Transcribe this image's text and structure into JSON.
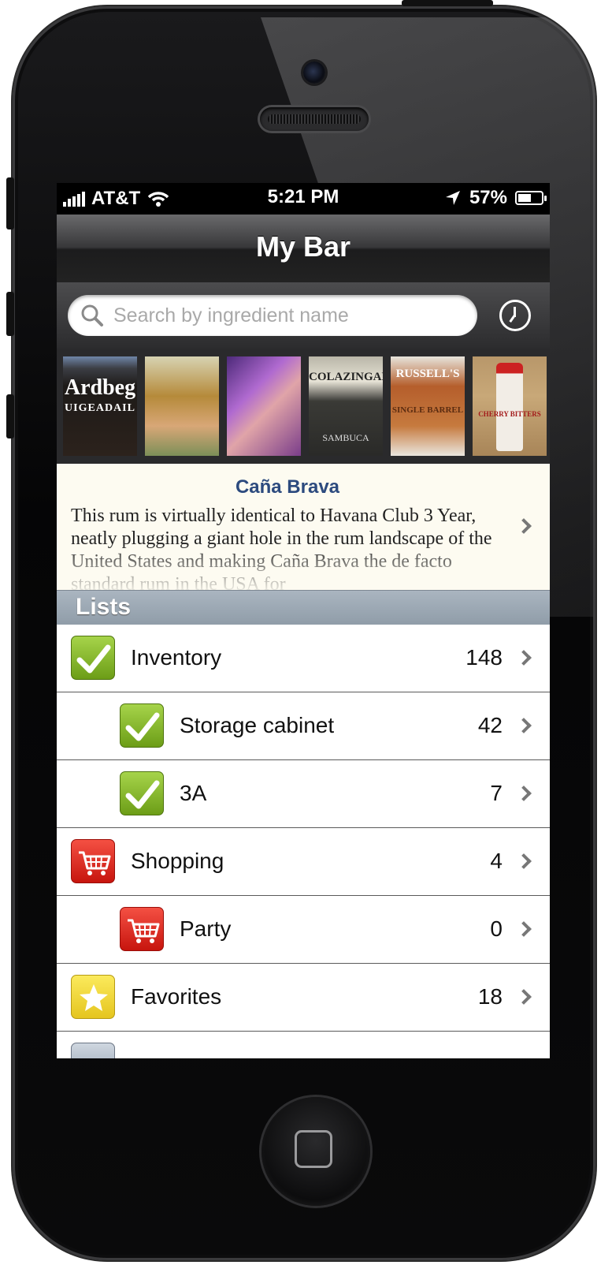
{
  "status_bar": {
    "carrier": "AT&T",
    "time": "5:21 PM",
    "battery": "57%",
    "battery_level": 0.57,
    "signal_icon": "signal-bars-icon",
    "wifi_icon": "wifi-icon",
    "location_icon": "location-arrow-icon",
    "battery_icon": "battery-icon"
  },
  "nav": {
    "title": "My Bar"
  },
  "search": {
    "placeholder": "Search by ingredient name",
    "value": ""
  },
  "thumbnails": [
    {
      "caption": "Ardbeg",
      "sub": "UIGEADAIL"
    },
    {
      "caption": "",
      "sub": ""
    },
    {
      "caption": "",
      "sub": ""
    },
    {
      "caption": "COLAZINGARI",
      "sub": "SAMBUCA"
    },
    {
      "caption": "RUSSELL'S",
      "sub": "SINGLE BARREL"
    },
    {
      "caption": "",
      "sub": "CHERRY BITTERS"
    }
  ],
  "featured": {
    "title": "Caña Brava",
    "body": "This rum is virtually identical to Havana Club 3 Year, neatly plugging a giant hole in the rum landscape of the United States and making Caña Brava the de facto standard rum in the USA for"
  },
  "lists_header": "Lists",
  "list_items": [
    {
      "name": "Inventory",
      "count": "148",
      "icon": "checkmark-icon"
    },
    {
      "name": "Storage cabinet",
      "count": "42",
      "icon": "checkmark-icon"
    },
    {
      "name": "3A",
      "count": "7",
      "icon": "checkmark-icon"
    },
    {
      "name": "Shopping",
      "count": "4",
      "icon": "shopping-cart-icon"
    },
    {
      "name": "Party",
      "count": "0",
      "icon": "shopping-cart-icon"
    },
    {
      "name": "Favorites",
      "count": "18",
      "icon": "star-icon"
    }
  ],
  "colors": {
    "featured_title": "#2c4a7e",
    "check_green": "#8bbd2c",
    "cart_red": "#e0261c",
    "star_yellow": "#f2d63a"
  }
}
